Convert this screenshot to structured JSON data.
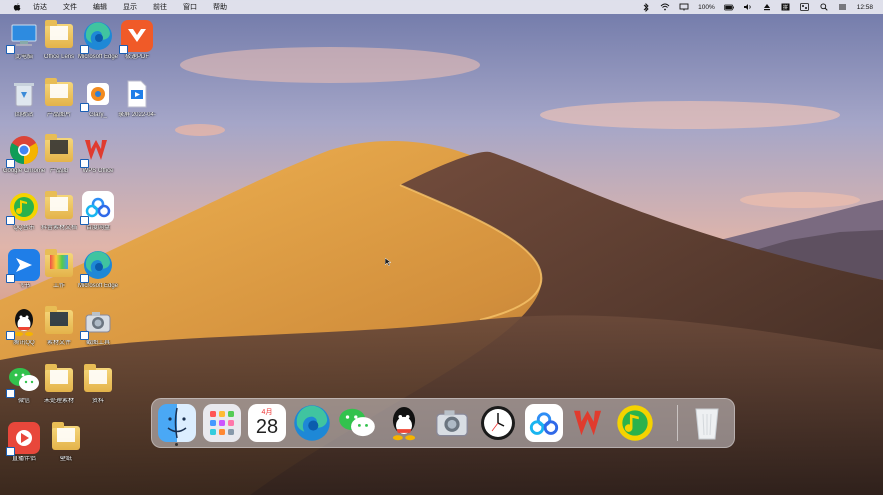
{
  "menubar": {
    "menus": [
      "访达",
      "文件",
      "编辑",
      "显示",
      "前往",
      "窗口",
      "帮助"
    ],
    "status": {
      "battery": "100%",
      "clock": "12:58"
    }
  },
  "desktop_icons": [
    {
      "label": "此电脑",
      "icon": "computer-icon"
    },
    {
      "label": "Office Lens",
      "icon": "folder-icon"
    },
    {
      "label": "Microsoft Edge",
      "icon": "edge-icon"
    },
    {
      "label": "极速PDF",
      "icon": "pdf-app-icon"
    },
    {
      "label": "回收站",
      "icon": "recycle-bin-icon"
    },
    {
      "label": "产品图片",
      "icon": "folder-icon"
    },
    {
      "label": "Glary_",
      "icon": "utility-icon"
    },
    {
      "label": "录屏 2022-04-",
      "icon": "video-file-icon"
    },
    {
      "label": "Google Chrome",
      "icon": "chrome-icon"
    },
    {
      "label": "产品图",
      "icon": "folder-icon"
    },
    {
      "label": "WPS Office",
      "icon": "wps-icon"
    },
    {
      "label": "QQ音乐",
      "icon": "qq-music-icon"
    },
    {
      "label": "抖音素材文档",
      "icon": "folder-icon"
    },
    {
      "label": "百度网盘",
      "icon": "baidu-netdisk-icon"
    },
    {
      "label": "飞书",
      "icon": "feishu-icon"
    },
    {
      "label": "工作",
      "icon": "folder-icon"
    },
    {
      "label": "Microsoft Edge",
      "icon": "edge-icon"
    },
    {
      "label": "腾讯QQ",
      "icon": "qq-icon"
    },
    {
      "label": "素材文件",
      "icon": "folder-icon"
    },
    {
      "label": "截图工具",
      "icon": "screenshot-tool-icon"
    },
    {
      "label": "微信",
      "icon": "wechat-icon"
    },
    {
      "label": "未处理素材",
      "icon": "folder-icon"
    },
    {
      "label": "资料",
      "icon": "folder-icon"
    },
    {
      "label": "直播伴侣",
      "icon": "live-app-icon"
    },
    {
      "label": "壁纸",
      "icon": "folder-icon"
    }
  ],
  "dock": {
    "items": [
      {
        "name": "finder",
        "icon": "finder-icon"
      },
      {
        "name": "launchpad",
        "icon": "launchpad-icon"
      },
      {
        "name": "calendar",
        "icon": "calendar-icon",
        "month": "4月",
        "day": "28"
      },
      {
        "name": "edge",
        "icon": "edge-icon"
      },
      {
        "name": "wechat",
        "icon": "wechat-icon"
      },
      {
        "name": "qq",
        "icon": "qq-icon"
      },
      {
        "name": "screenshot",
        "icon": "screenshot-tool-icon"
      },
      {
        "name": "clock",
        "icon": "clock-icon"
      },
      {
        "name": "baidu-netdisk",
        "icon": "baidu-netdisk-icon"
      },
      {
        "name": "wps",
        "icon": "wps-icon"
      },
      {
        "name": "qq-music",
        "icon": "qq-music-icon"
      },
      {
        "name": "trash",
        "icon": "trash-icon"
      }
    ]
  },
  "colors": {
    "sand_light": "#e6a84a",
    "sand_dark": "#5a3b2a",
    "menubar_bg": "#eeeef4",
    "edge_blue": "#1e88d6",
    "wps_red": "#e03b2e",
    "wechat_green": "#32c24d",
    "qq_music_yellow": "#f5d300"
  }
}
